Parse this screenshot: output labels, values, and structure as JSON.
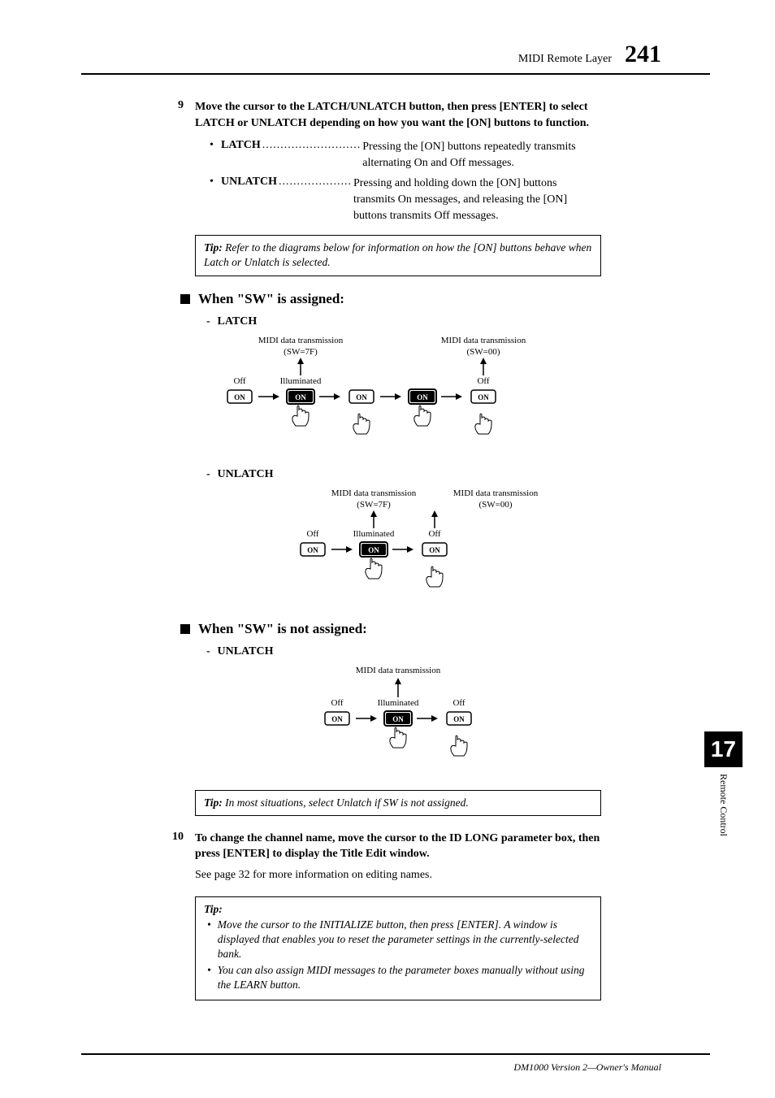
{
  "header": {
    "section": "MIDI Remote Layer",
    "page": "241"
  },
  "step9": {
    "num": "9",
    "title": "Move the cursor to the LATCH/UNLATCH button, then press [ENTER] to select LATCH or UNLATCH depending on how you want the [ON] buttons to function.",
    "latch_term": "LATCH",
    "latch_dots": "...........................",
    "latch_text": "Pressing the [ON] buttons repeatedly transmits alternating On and Off messages.",
    "unlatch_term": "UNLATCH",
    "unlatch_dots": "....................",
    "unlatch_text": "Pressing and holding down the [ON] buttons transmits On messages, and releasing the [ON] buttons transmits Off messages."
  },
  "tip1": {
    "label": "Tip:",
    "text": "Refer to the diagrams below for information on how the [ON] buttons behave when Latch or Unlatch is selected."
  },
  "section_sw_assigned": "When \"SW\" is assigned:",
  "latch_label": "LATCH",
  "unlatch_label": "UNLATCH",
  "section_sw_not_assigned": "When \"SW\" is not assigned:",
  "tip2": {
    "label": "Tip:",
    "text": "In most situations, select Unlatch if SW is not assigned."
  },
  "step10": {
    "num": "10",
    "title": "To change the channel name, move the cursor to the ID LONG parameter box, then press [ENTER] to display the Title Edit window.",
    "body": "See page 32 for more information on editing names."
  },
  "tip3": {
    "label": "Tip:",
    "bullet1": "Move the cursor to the INITIALIZE button, then press [ENTER]. A window is displayed that enables you to reset the parameter settings in the currently-selected bank.",
    "bullet2": "You can also assign MIDI messages to the parameter boxes manually without using the LEARN button."
  },
  "diagrams": {
    "midi_label": "MIDI data transmission",
    "sw7f": "(SW=7F)",
    "sw00": "(SW=00)",
    "off": "Off",
    "illuminated": "Illuminated",
    "on": "ON"
  },
  "side": {
    "num": "17",
    "text": "Remote Control"
  },
  "footer": "DM1000 Version 2—Owner's Manual"
}
